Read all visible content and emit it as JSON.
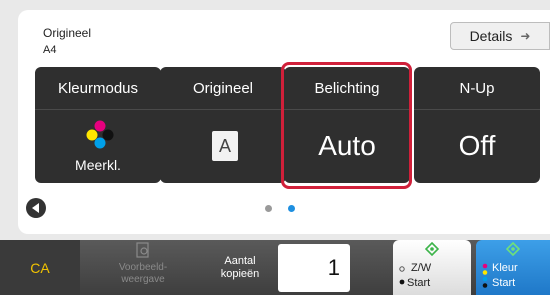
{
  "original_info": {
    "label": "Origineel",
    "size": "A4"
  },
  "details_button": {
    "label": "Details"
  },
  "tiles": [
    {
      "title": "Kleurmodus",
      "value": "Meerkl."
    },
    {
      "title": "Origineel",
      "value": "A"
    },
    {
      "title": "Belichting",
      "value": "Auto"
    },
    {
      "title": "N-Up",
      "value": "Off"
    }
  ],
  "pagination": {
    "current_page": 2,
    "page_count": 2
  },
  "bottom_bar": {
    "ca_label": "CA",
    "preview_line1": "Voorbeeld-",
    "preview_line2": "weergave",
    "copies_line1": "Aantal",
    "copies_line2": "kopieën",
    "copies_value": "1",
    "bw_line1": "Z/W",
    "bw_line2": "Start",
    "color_line1": "Kleur",
    "color_line2": "Start"
  },
  "colors": {
    "highlight": "#d0203a",
    "tile_background": "#2f2f2f",
    "ca_text": "#f2c300",
    "start_green": "#3cb44a",
    "start_blue": "#1f78c8",
    "active_dot": "#1e8fe0"
  },
  "icons": [
    "color-dots-icon",
    "original-a-icon",
    "left-arrow-icon",
    "preview-icon",
    "start-diamond-icon",
    "arrow-right-icon"
  ]
}
